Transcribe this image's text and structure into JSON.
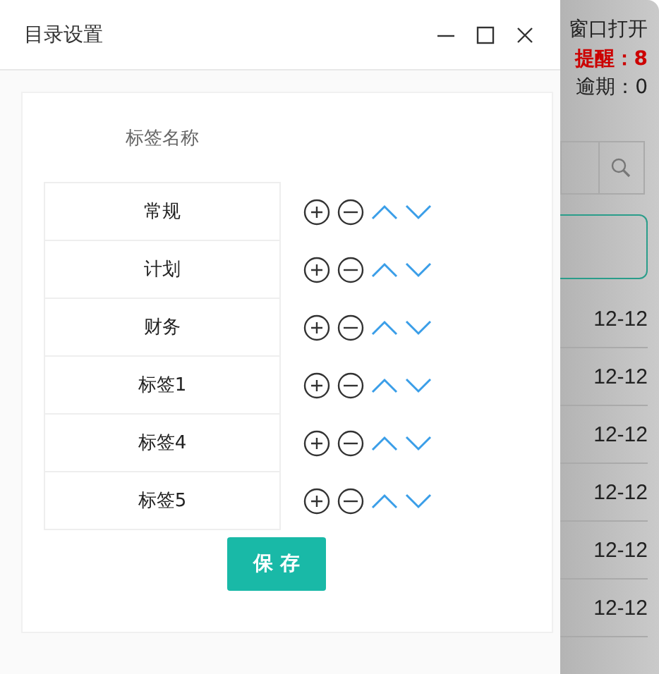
{
  "dialog": {
    "title": "目录设置",
    "column_header": "标签名称",
    "tags": [
      {
        "name": "常规"
      },
      {
        "name": "计划"
      },
      {
        "name": "财务"
      },
      {
        "name": "标签1"
      },
      {
        "name": "标签4"
      },
      {
        "name": "标签5"
      }
    ],
    "save_button": "保 存"
  },
  "background": {
    "open_text": "窗口打开",
    "reminder": "提醒：8",
    "overdue": "逾期：0",
    "dates": [
      "12-12",
      "12-12",
      "12-12",
      "12-12",
      "12-12",
      "12-12"
    ]
  }
}
